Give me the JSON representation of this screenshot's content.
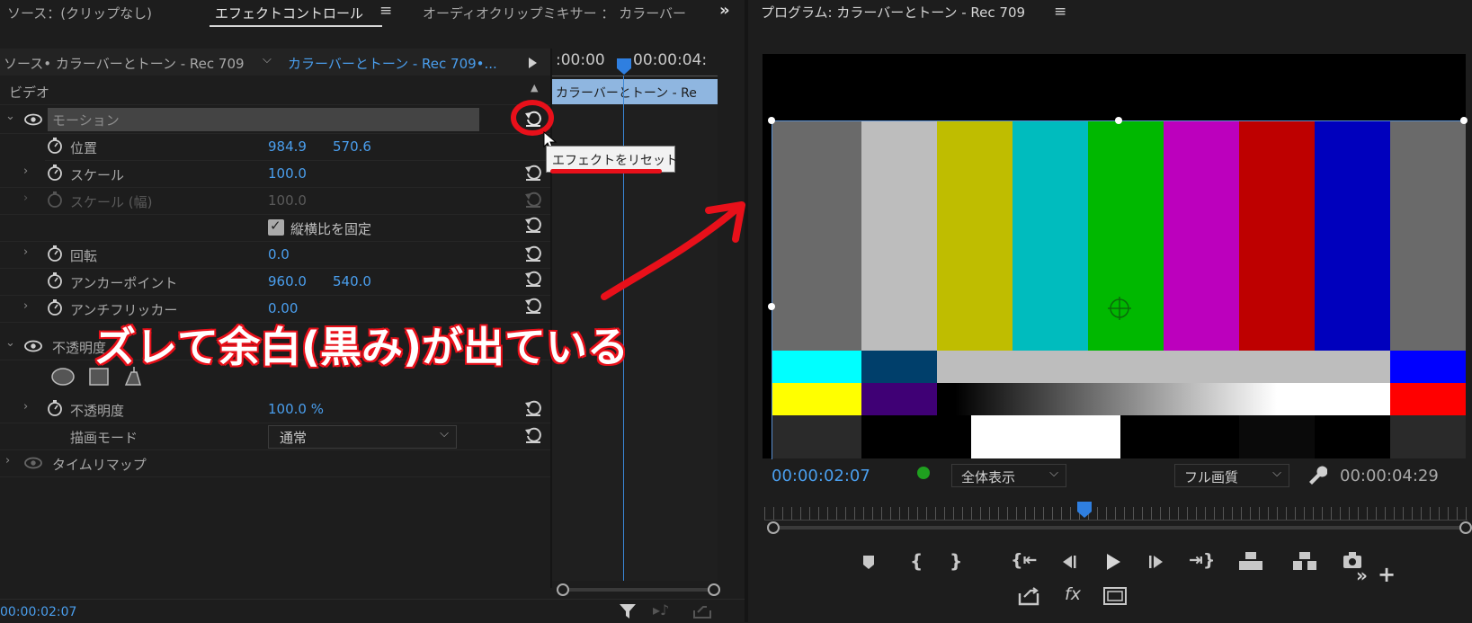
{
  "left_tabs": {
    "source": "ソース：(クリップなし)",
    "effect_controls": "エフェクトコントロール",
    "audio_mixer": "オーディオクリップミキサー ： カラーバー"
  },
  "effect_controls": {
    "source_label": "ソース• カラーバーとトーン - Rec 709",
    "sequence_label": "カラーバーとトーン - Rec 709•...",
    "time_start": ":00:00",
    "time_end": "00:00:04:",
    "clip_label": "カラーバーとトーン - Re",
    "section_video": "ビデオ",
    "motion": "モーション",
    "position_label": "位置",
    "position_x": "984.9",
    "position_y": "570.6",
    "scale_label": "スケール",
    "scale_value": "100.0",
    "scale_width_label": "スケール (幅)",
    "scale_width_value": "100.0",
    "uniform_scale_label": "縦横比を固定",
    "rotation_label": "回転",
    "rotation_value": "0.0",
    "anchor_label": "アンカーポイント",
    "anchor_x": "960.0",
    "anchor_y": "540.0",
    "antiflicker_label": "アンチフリッカー",
    "antiflicker_value": "0.00",
    "opacity_section": "不透明度",
    "opacity_label": "不透明度",
    "opacity_value": "100.0 %",
    "blend_mode_label": "描画モード",
    "blend_mode_value": "通常",
    "time_remap": "タイムリマップ",
    "tooltip": "エフェクトをリセット",
    "current_time": "00:00:02:07"
  },
  "annotation": {
    "text": "ズレて余白(黒み)が出ている",
    "color": "#e8101a"
  },
  "program": {
    "title": "プログラム: カラーバーとトーン - Rec 709",
    "timecode": "00:00:02:07",
    "zoom": "全体表示",
    "quality": "フル画質",
    "duration": "00:00:04:29",
    "playhead_fraction": 0.45
  }
}
